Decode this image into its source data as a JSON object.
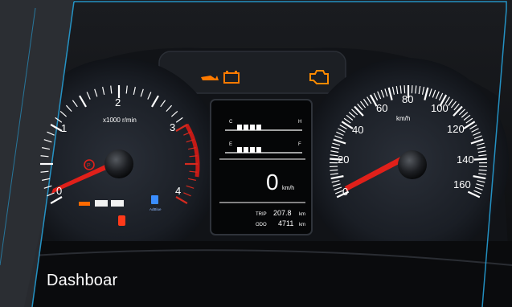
{
  "caption": "Dashboar",
  "tachometer": {
    "unit": "x1000 r/min",
    "ticks": [
      "0",
      "1",
      "2",
      "3",
      "4"
    ]
  },
  "speedometer": {
    "unit": "km/h",
    "ticks": [
      "0",
      "20",
      "40",
      "60",
      "80",
      "100",
      "120",
      "140",
      "160"
    ]
  },
  "center_display": {
    "temp_high": "H",
    "temp_low": "C",
    "fuel_full": "F",
    "fuel_empty": "E",
    "speed_value": "0",
    "speed_unit": "km/h",
    "trip_label": "TRIP",
    "trip_value": "207.8",
    "trip_unit": "km",
    "odo_label": "ODO",
    "odo_value": "4711",
    "odo_unit": "km"
  },
  "warning_lights": [
    "oil-pressure-icon",
    "battery-icon",
    "check-engine-icon",
    "parking-brake-icon",
    "seatbelt-icon",
    "adblue-icon"
  ],
  "adblue_label": "AdBlue",
  "colors": {
    "needle": "#e0201a",
    "amber": "#ff7a00",
    "frame_accent": "#27a7e1"
  }
}
